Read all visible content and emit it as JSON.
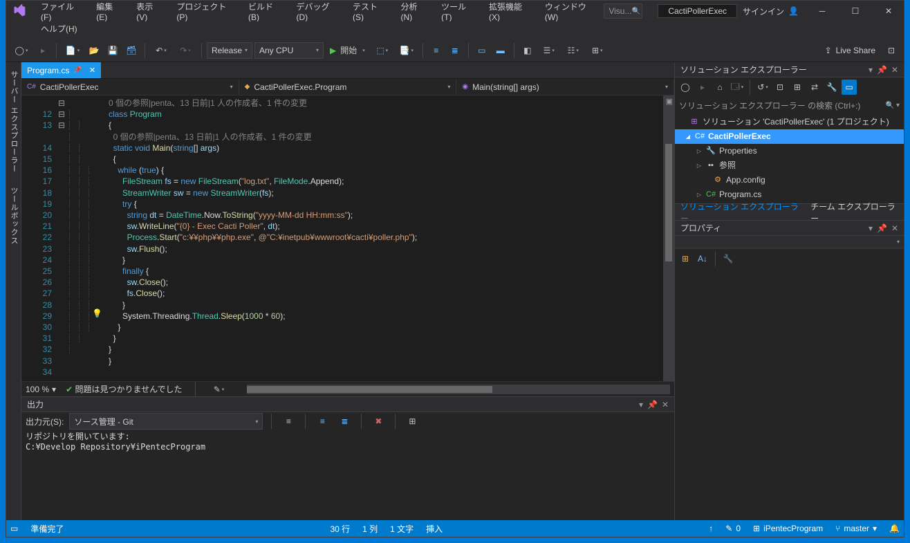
{
  "menu": {
    "file": "ファイル(F)",
    "edit": "編集(E)",
    "view": "表示(V)",
    "project": "プロジェクト(P)",
    "build": "ビルド(B)",
    "debug": "デバッグ(D)",
    "test": "テスト(S)",
    "analyze": "分析(N)",
    "tools": "ツール(T)",
    "extensions": "拡張機能(X)",
    "window": "ウィンドウ(W)",
    "help": "ヘルプ(H)"
  },
  "title": {
    "search_placeholder": "Visu...",
    "app": "CactiPollerExec",
    "signin": "サインイン"
  },
  "toolbar": {
    "config": "Release",
    "platform": "Any CPU",
    "start": "開始",
    "liveshare": "Live Share"
  },
  "doctab": {
    "name": "Program.cs"
  },
  "nav": {
    "project": "CactiPollerExec",
    "class": "CactiPollerExec.Program",
    "method": "Main(string[] args)"
  },
  "leftrail": {
    "tab1": "サーバー エクスプローラー",
    "tab2": "ツールボックス"
  },
  "editor": {
    "lines": [
      "12",
      "13",
      "14",
      "15",
      "16",
      "17",
      "18",
      "19",
      "20",
      "21",
      "22",
      "23",
      "24",
      "25",
      "26",
      "27",
      "28",
      "29",
      "30",
      "31",
      "32",
      "33",
      "34"
    ],
    "ref1": "0 個の参照|penta、13 日前|1 人の作成者、1 件の変更",
    "ref2": "0 個の参照|penta、13 日前|1 人の作成者、1 件の変更",
    "zoom": "100 %",
    "noissues": "問題は見つかりませんでした"
  },
  "output": {
    "title": "出力",
    "sourcelabel": "出力元(S):",
    "source": "ソース管理 - Git",
    "body": "リポジトリを開いています:\nC:¥Develop Repository¥iPentecProgram"
  },
  "solexp": {
    "title": "ソリューション エクスプローラー",
    "search_placeholder": "ソリューション エクスプローラー の検索 (Ctrl+:)",
    "sol": "ソリューション 'CactiPollerExec' (1 プロジェクト)",
    "proj": "CactiPollerExec",
    "properties": "Properties",
    "refs": "参照",
    "appconfig": "App.config",
    "programcs": "Program.cs",
    "tab_sol": "ソリューション エクスプローラー",
    "tab_team": "チーム エクスプローラー"
  },
  "props": {
    "title": "プロパティ"
  },
  "status": {
    "ready": "準備完了",
    "line": "30 行",
    "col": "1 列",
    "chars": "1 文字",
    "ins": "挿入",
    "pencil": "0",
    "repo": "iPentecProgram",
    "branch": "master"
  }
}
